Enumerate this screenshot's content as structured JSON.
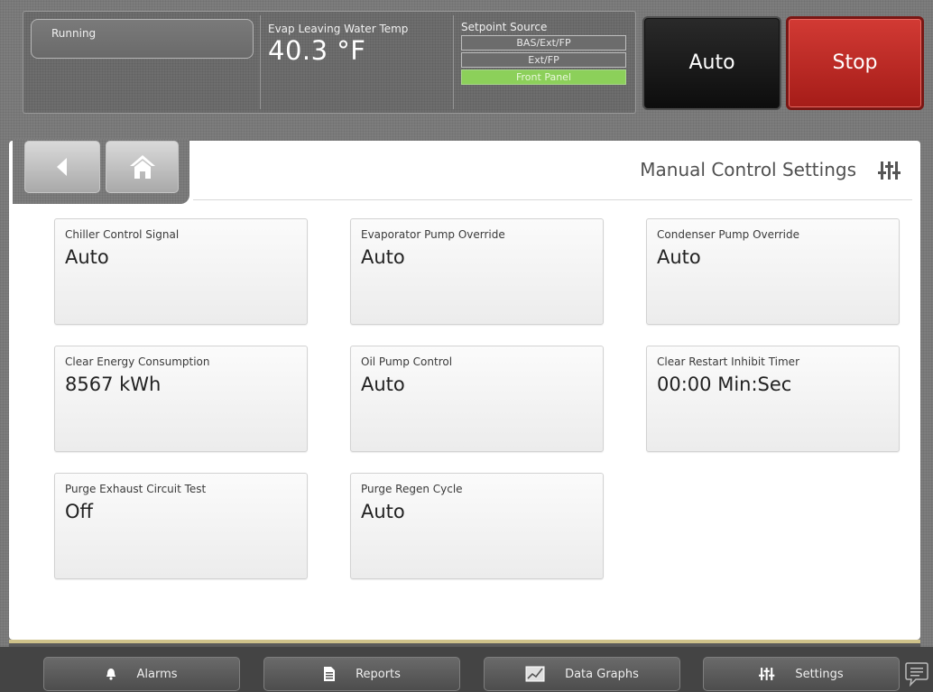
{
  "header": {
    "status": "Running",
    "evap_label": "Evap Leaving Water Temp",
    "evap_value": "40.3 °F",
    "setpoint_source": {
      "title": "Setpoint Source",
      "options": [
        "BAS/Ext/FP",
        "Ext/FP",
        "Front Panel"
      ],
      "active": "Front Panel"
    },
    "auto_label": "Auto",
    "stop_label": "Stop"
  },
  "page": {
    "title": "Manual Control Settings"
  },
  "tiles": [
    {
      "label": "Chiller Control Signal",
      "value": "Auto"
    },
    {
      "label": "Evaporator Pump Override",
      "value": "Auto"
    },
    {
      "label": "Condenser Pump Override",
      "value": "Auto"
    },
    {
      "label": "Clear Energy Consumption",
      "value": "8567 kWh"
    },
    {
      "label": "Oil Pump Control",
      "value": "Auto"
    },
    {
      "label": "Clear Restart Inhibit Timer",
      "value": "00:00 Min:Sec"
    },
    {
      "label": "Purge Exhaust Circuit Test",
      "value": "Off"
    },
    {
      "label": "Purge Regen Cycle",
      "value": "Auto"
    }
  ],
  "bottom_nav": {
    "alarms": "Alarms",
    "reports": "Reports",
    "data_graphs": "Data Graphs",
    "settings": "Settings"
  },
  "colors": {
    "stop_red": "#b8231f",
    "active_green": "#8cd05a"
  },
  "icons": {
    "back": "back-arrow-icon",
    "home": "home-icon",
    "settings": "sliders-icon",
    "alarms": "bell-icon",
    "reports": "document-icon",
    "data_graphs": "graph-icon",
    "chat": "chat-icon"
  }
}
